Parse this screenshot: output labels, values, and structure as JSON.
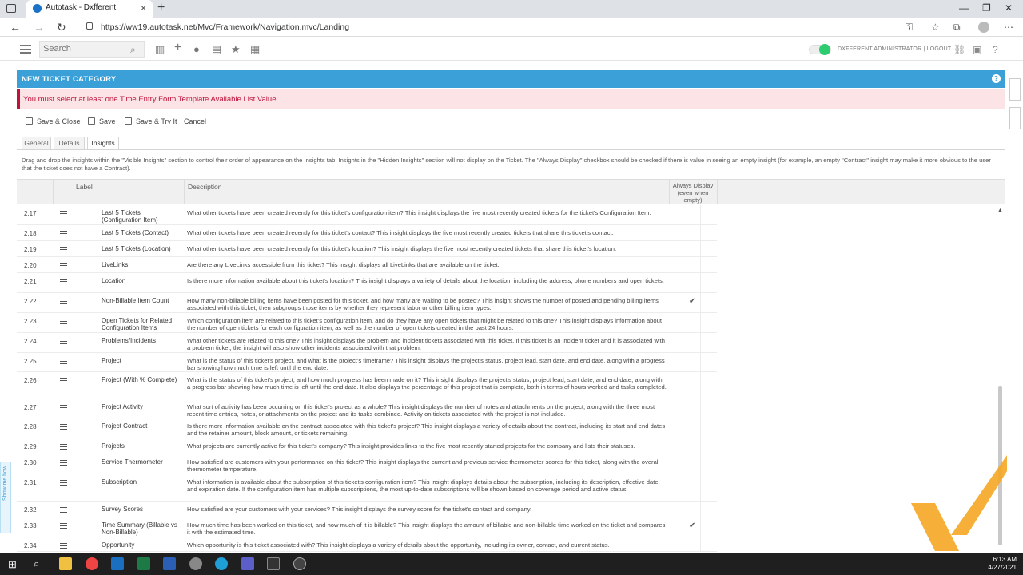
{
  "browser": {
    "tab_title": "Autotask - Dxfferent",
    "url": "https://ww19.autotask.net/Mvc/Framework/Navigation.mvc/Landing"
  },
  "toolbar": {
    "search_placeholder": "Search",
    "user_label": "DXFFERENT ADMINISTRATOR | LOGOUT"
  },
  "page": {
    "title": "NEW TICKET CATEGORY",
    "error_message": "You must select at least one Time Entry Form Template Available List Value",
    "buttons": [
      "Save & Close",
      "Save",
      "Save & Try It",
      "Cancel"
    ],
    "tabs": [
      "General",
      "Details",
      "Insights"
    ],
    "active_tab": "Insights",
    "intro": "Drag and drop the insights within the \"Visible Insights\" section to control their order of appearance on the Insights tab. Insights in the \"Hidden Insights\" section will not display on the Ticket. The \"Always Display\" checkbox should be checked if there is value in seeing an empty insight (for example, an empty \"Contract\" insight may make it more obvious to the user that the ticket does not have a Contract)."
  },
  "table": {
    "headers": {
      "label": "Label",
      "description": "Description",
      "always": "Always Display (even when empty)"
    },
    "rows": [
      {
        "num": "2.17",
        "label": "Last 5 Tickets (Configuration Item)",
        "desc": "What other tickets have been created recently for this ticket's configuration item? This insight displays the five most recently created tickets for the ticket's Configuration Item.",
        "always": false
      },
      {
        "num": "2.18",
        "label": "Last 5 Tickets (Contact)",
        "desc": "What other tickets have been created recently for this ticket's contact? This insight displays the five most recently created tickets that share this ticket's contact.",
        "always": false
      },
      {
        "num": "2.19",
        "label": "Last 5 Tickets (Location)",
        "desc": "What other tickets have been created recently for this ticket's location? This insight displays the five most recently created tickets that share this ticket's location.",
        "always": false
      },
      {
        "num": "2.20",
        "label": "LiveLinks",
        "desc": "Are there any LiveLinks accessible from this ticket? This insight displays all LiveLinks that are available on the ticket.",
        "always": false
      },
      {
        "num": "2.21",
        "label": "Location",
        "desc": "Is there more information available about this ticket's location? This insight displays a variety of details about the location, including the address, phone numbers and open tickets.",
        "always": false
      },
      {
        "num": "2.22",
        "label": "Non-Billable Item Count",
        "desc": "How many non-billable billing items have been posted for this ticket, and how many are waiting to be posted? This insight shows the number of posted and pending billing items associated with this ticket, then subgroups those items by whether they represent labor or other billing item types.",
        "always": true
      },
      {
        "num": "2.23",
        "label": "Open Tickets for Related Configuration Items",
        "desc": "Which configuration item are related to this ticket's configuration item, and do they have any open tickets that might be related to this one? This insight displays information about the number of open tickets for each configuration item, as well as the number of open tickets created in the past 24 hours.",
        "always": false
      },
      {
        "num": "2.24",
        "label": "Problems/Incidents",
        "desc": "What other tickets are related to this one? This insight displays the problem and incident tickets associated with this ticket. If this ticket is an incident ticket and it is associated with a problem ticket, the insight will also show other incidents associated with that problem.",
        "always": false
      },
      {
        "num": "2.25",
        "label": "Project",
        "desc": "What is the status of this ticket's project, and what is the project's timeframe? This insight displays the project's status, project lead, start date, and end date, along with a progress bar showing how much time is left until the end date.",
        "always": false
      },
      {
        "num": "2.26",
        "label": "Project (With % Complete)",
        "desc": "What is the status of this ticket's project, and how much progress has been made on it? This insight displays the project's status, project lead, start date, and end date, along with a progress bar showing how much time is left until the end date. It also displays the percentage of this project that is complete, both in terms of hours worked and tasks completed.",
        "always": false
      },
      {
        "num": "2.27",
        "label": "Project Activity",
        "desc": "What sort of activity has been occurring on this ticket's project as a whole? This insight displays the number of notes and attachments on the project, along with the three most recent time entries, notes, or attachments on the project and its tasks combined. Activity on tickets associated with the project is not included.",
        "always": false
      },
      {
        "num": "2.28",
        "label": "Project Contract",
        "desc": "Is there more information available on the contract associated with this ticket's project? This insight displays a variety of details about the contract, including its start and end dates and the retainer amount, block amount, or tickets remaining.",
        "always": false
      },
      {
        "num": "2.29",
        "label": "Projects",
        "desc": "What projects are currently active for this ticket's company? This insight provides links to the five most recently started projects for the company and lists their statuses.",
        "always": false
      },
      {
        "num": "2.30",
        "label": "Service Thermometer",
        "desc": "How satisfied are customers with your performance on this ticket? This insight displays the current and previous service thermometer scores for this ticket, along with the overall thermometer temperature.",
        "always": false
      },
      {
        "num": "2.31",
        "label": "Subscription",
        "desc": "What information is available about the subscription of this ticket's configuration item? This insight displays details about the subscription, including its description, effective date, and expiration date. If the configuration item has multiple subscriptions, the most up-to-date subscriptions will be shown based on coverage period and active status.",
        "always": false
      },
      {
        "num": "2.32",
        "label": "Survey Scores",
        "desc": "How satisfied are your customers with your services? This insight displays the survey score for the ticket's contact and company.",
        "always": false
      },
      {
        "num": "2.33",
        "label": "Time Summary (Billable vs Non-Billable)",
        "desc": "How much time has been worked on this ticket, and how much of it is billable? This insight displays the amount of billable and non-billable time worked on the ticket and compares it with the estimated time.",
        "always": true
      },
      {
        "num": "2.34",
        "label": "Opportunity",
        "desc": "Which opportunity is this ticket associated with? This insight displays a variety of details about the opportunity, including its owner, contact, and current status.",
        "always": false
      }
    ]
  },
  "side_widget": {
    "show_me_how": "Show me how"
  },
  "taskbar": {
    "time": "6:13 AM",
    "date": "4/27/2021"
  },
  "colors": {
    "title_bar": "#3ba0d8",
    "error_bg": "#fbe3e6",
    "error_text": "#c0133a",
    "toggle_on": "#2ecc71",
    "watermark": "#f5a623"
  }
}
